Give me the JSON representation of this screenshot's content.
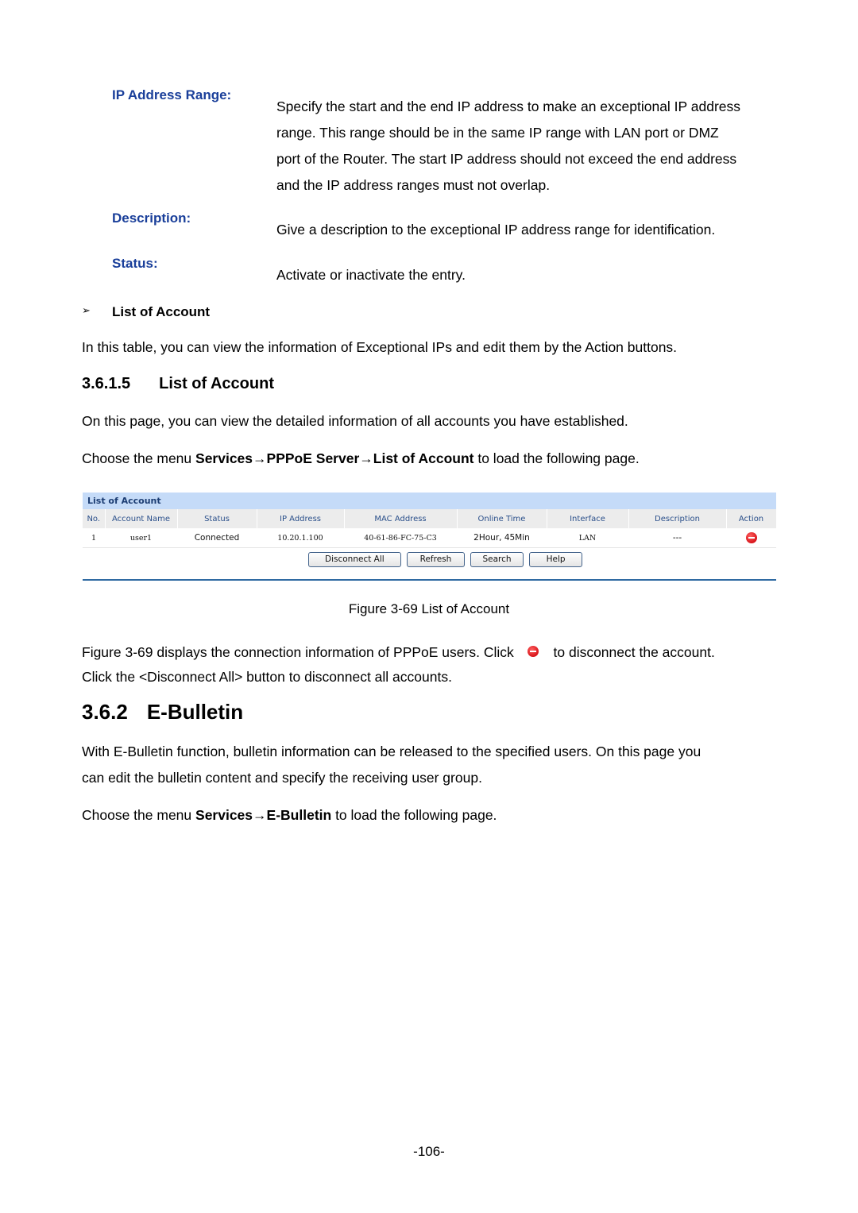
{
  "definitions": [
    {
      "term": "IP Address Range:",
      "lines": [
        "Specify the start and the end IP address to make an exceptional IP address",
        "range. This range should be in the same IP range with LAN port or DMZ",
        "port of the Router. The start IP address should not exceed the end address",
        "and the IP address ranges must not overlap."
      ]
    },
    {
      "term": "Description:",
      "lines": [
        "Give a description to the exceptional IP address range for identification."
      ]
    },
    {
      "term": "Status:",
      "lines": [
        "Activate or inactivate the entry."
      ]
    }
  ],
  "bullet": {
    "marker": "➢",
    "label": "List of Account"
  },
  "bullet_text": "In this table, you can view the information of Exceptional IPs and edit them by the Action buttons.",
  "section_3615": {
    "number": "3.6.1.5",
    "title": "List of Account",
    "intro": "On this page, you can view the detailed information of all accounts you have established.",
    "menu_prefix": "Choose the menu ",
    "menu_path_1": "Services",
    "menu_arrow": "→",
    "menu_path_2": "PPPoE Server",
    "menu_path_3": "List of Account",
    "menu_suffix": " to load the following page."
  },
  "figure": {
    "panel_title": "List of Account",
    "columns": [
      "No.",
      "Account Name",
      "Status",
      "IP Address",
      "MAC Address",
      "Online Time",
      "Interface",
      "Description",
      "Action"
    ],
    "rows": [
      {
        "no": "1",
        "account_name": "user1",
        "status": "Connected",
        "ip": "10.20.1.100",
        "mac": "40-61-86-FC-75-C3",
        "online_time": "2Hour, 45Min",
        "interface": "LAN",
        "description": "---",
        "action_icon": "disconnect-icon"
      }
    ],
    "buttons": [
      "Disconnect All",
      "Refresh",
      "Search",
      "Help"
    ],
    "caption": "Figure 3-69 List of Account"
  },
  "after_figure": {
    "line1_a": "Figure 3-69 displays the connection information of PPPoE users. Click",
    "line1_b": "to disconnect the account.",
    "line2": "Click the <Disconnect All> button to disconnect all accounts."
  },
  "section_362": {
    "number": "3.6.2",
    "title": "E-Bulletin",
    "para_lines": [
      "With E-Bulletin function, bulletin information can be released to the specified users. On this page you",
      "can edit the bulletin content and specify the receiving user group."
    ],
    "menu_prefix": "Choose the menu ",
    "menu_path_1": "Services",
    "menu_arrow": "→",
    "menu_path_2": "E-Bulletin",
    "menu_suffix": " to load the following page."
  },
  "page_number": "-106-"
}
